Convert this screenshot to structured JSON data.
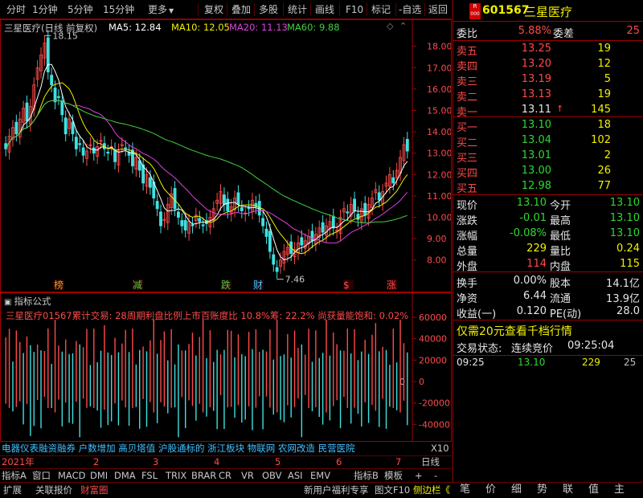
{
  "toolbar": {
    "items": [
      "分时",
      "1分钟",
      "5分钟",
      "15分钟",
      "更多",
      "复权",
      "叠加",
      "多股",
      "统计",
      "画线",
      "F10",
      "标记",
      "-自选",
      "返回"
    ]
  },
  "main_chart": {
    "title": "三星医疗(日线 前复权)",
    "ma5": "MA5: 12.84",
    "ma10": "MA10: 12.05",
    "ma20": "MA20: 11.13",
    "ma60": "MA60: 9.88",
    "high_label": "18.15",
    "low_label": "7.46",
    "y_ticks": [
      "18.00",
      "17.00",
      "16.00",
      "15.00",
      "14.00",
      "13.00",
      "12.00",
      "11.00",
      "10.00",
      "9.00",
      "8.00"
    ],
    "markers": [
      "榜",
      "减",
      "跌",
      "财",
      "$",
      "涨"
    ]
  },
  "indicator": {
    "title": "指标公式",
    "line": "三星医疗01567累计交易: 28周期利盘比例上市百账度比 10.8%筹: 22.2% 尚获量能饱和: 0.02%",
    "y_ticks": [
      "60000",
      "40000",
      "20000",
      "0",
      "-20000",
      "-40000"
    ],
    "zero_label": "0"
  },
  "ticker_line": "电器仪表融资融券 户数增加 高贝塔值 沪股通标的 浙江板块 物联网 农网改造 民营医院",
  "ticker_tail": "X10",
  "date_row": {
    "year": "2021年",
    "months": [
      "2",
      "3",
      "4",
      "5",
      "6",
      "7"
    ],
    "period": "日线"
  },
  "ind_tabs": [
    "指标A",
    "窗口",
    "MACD",
    "DMI",
    "DMA",
    "FSL",
    "TRIX",
    "BRAR",
    "CR",
    "VR",
    "OBV",
    "ASI",
    "EMV",
    "指标B",
    "模板",
    "+",
    "-"
  ],
  "quote": {
    "code": "601567",
    "name": "三星医疗",
    "badge_top": "R",
    "badge_bottom": "000",
    "weibi_label": "委比",
    "weibi": "5.88%",
    "weicha_label": "委差",
    "weicha": "25",
    "asks": [
      {
        "label": "卖五",
        "price": "13.25",
        "vol": "19"
      },
      {
        "label": "卖四",
        "price": "13.20",
        "vol": "12"
      },
      {
        "label": "卖三",
        "price": "13.19",
        "vol": "5"
      },
      {
        "label": "卖二",
        "price": "13.13",
        "vol": "19"
      },
      {
        "label": "卖一",
        "price": "13.11",
        "vol": "145"
      }
    ],
    "bids": [
      {
        "label": "买一",
        "price": "13.10",
        "vol": "18"
      },
      {
        "label": "买二",
        "price": "13.04",
        "vol": "102"
      },
      {
        "label": "买三",
        "price": "13.01",
        "vol": "2"
      },
      {
        "label": "买四",
        "price": "13.00",
        "vol": "26"
      },
      {
        "label": "买五",
        "price": "12.98",
        "vol": "77"
      }
    ],
    "stats": [
      {
        "l1": "现价",
        "v1": "13.10",
        "l2": "今开",
        "v2": "13.10"
      },
      {
        "l1": "涨跌",
        "v1": "-0.01",
        "l2": "最高",
        "v2": "13.10"
      },
      {
        "l1": "涨幅",
        "v1": "-0.08%",
        "l2": "最低",
        "v2": "13.10"
      },
      {
        "l1": "总量",
        "v1": "229",
        "l2": "量比",
        "v2": "0.24"
      },
      {
        "l1": "外盘",
        "v1": "114",
        "l2": "内盘",
        "v2": "115"
      }
    ],
    "fin": [
      {
        "l1": "换手",
        "v1": "0.00%",
        "l2": "股本",
        "v2": "14.1亿"
      },
      {
        "l1": "净资",
        "v1": "6.44",
        "l2": "流通",
        "v2": "13.9亿"
      },
      {
        "l1": "收益(一)",
        "v1": "0.120",
        "l2": "PE(动)",
        "v2": "28.0"
      }
    ],
    "promo": "仅需20元查看千档行情",
    "trade_state_label": "交易状态:",
    "trade_state": "连续竞价",
    "trade_time": "09:25:04",
    "tick_time": "09:25",
    "tick_price": "13.10",
    "tick_vol": "229",
    "tick_count": "25"
  },
  "status_bar": {
    "left": [
      "扩展",
      "关联报价",
      "财富圈"
    ],
    "promo": "新用户福利专享",
    "f10": "图文F10",
    "sidebar": "侧边栏《",
    "right_tabs": [
      "笔",
      "价",
      "细",
      "势",
      "联",
      "值",
      "主"
    ]
  }
}
